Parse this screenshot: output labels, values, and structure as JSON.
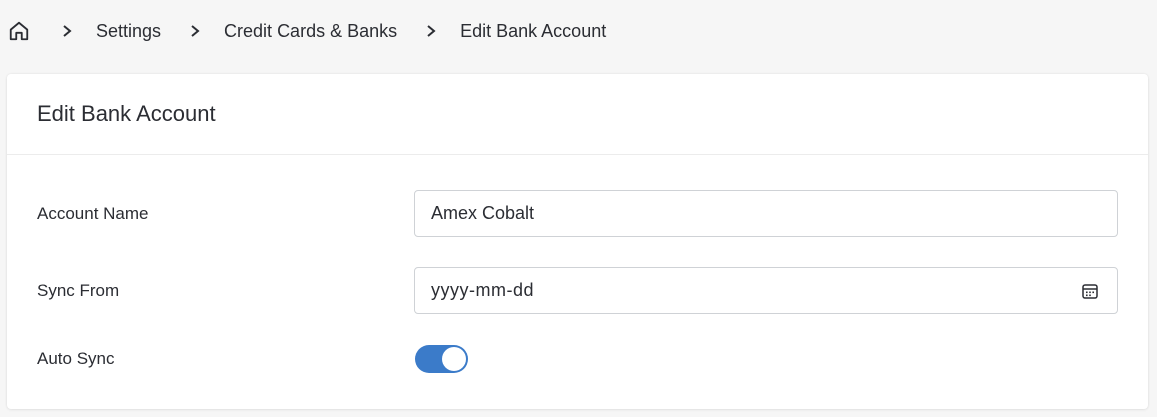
{
  "breadcrumb": {
    "home_icon": "home-icon",
    "items": [
      "Settings",
      "Credit Cards & Banks",
      "Edit Bank Account"
    ]
  },
  "card": {
    "title": "Edit Bank Account"
  },
  "form": {
    "account_name": {
      "label": "Account Name",
      "value": "Amex Cobalt"
    },
    "sync_from": {
      "label": "Sync From",
      "placeholder": "yyyy-mm-dd",
      "icon": "calendar-icon"
    },
    "auto_sync": {
      "label": "Auto Sync",
      "enabled": true
    }
  },
  "colors": {
    "accent": "#3b7bc9",
    "page_background": "#f6f6f6",
    "card_background": "#ffffff",
    "text": "#2b2d33"
  }
}
